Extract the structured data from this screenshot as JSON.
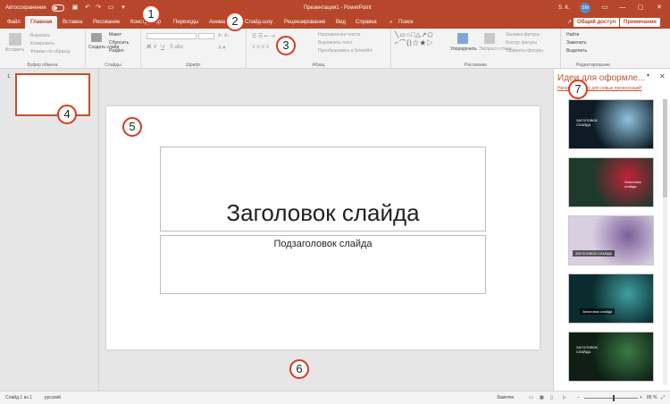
{
  "title_bar": {
    "autosave_label": "Автосохранение",
    "document_title": "Презентация1  -  PowerPoint",
    "user_initials": "SM",
    "user_short": "S. K."
  },
  "tabs": [
    "Файл",
    "Главная",
    "Вставка",
    "Рисование",
    "Конструктор",
    "Переходы",
    "Анимация",
    "Слайд-шоу",
    "Рецензирование",
    "Вид",
    "Справка"
  ],
  "search_label": "Поиск",
  "share_label": "Общий доступ",
  "comments_label": "Примечания",
  "ribbon": {
    "groups": [
      {
        "label": "Буфер обмена",
        "items": [
          "Вставить",
          "Вырезать",
          "Копировать",
          "Формат по образцу"
        ]
      },
      {
        "label": "Слайды",
        "items": [
          "Создать слайд",
          "Макет",
          "Сбросить",
          "Раздел"
        ]
      },
      {
        "label": "Шрифт",
        "items": []
      },
      {
        "label": "Абзац",
        "items": [
          "Направление текста",
          "Выровнять текст",
          "Преобразовать в SmartArt"
        ]
      },
      {
        "label": "Рисование",
        "items": [
          "Упорядочить",
          "Экспресс-стили",
          "Заливка фигуры",
          "Контур фигуры",
          "Эффекты фигуры"
        ]
      },
      {
        "label": "Редактирование",
        "items": [
          "Найти",
          "Заменить",
          "Выделить"
        ]
      }
    ]
  },
  "thumbnails": {
    "slide_number": "1"
  },
  "slide": {
    "title": "Заголовок слайда",
    "subtitle": "Подзаголовок слайда"
  },
  "designer": {
    "title": "Идеи для оформле...",
    "link": "Начните работу для новых презентаций!",
    "designs": [
      {
        "caption": "ЗАГОЛОВОК\nСЛАЙДА",
        "bg": "#0e1a24",
        "accent": "#8fc3dd"
      },
      {
        "caption": "Заголовок\nслайда",
        "bg": "#1d3a2c",
        "accent": "#c0223a"
      },
      {
        "caption": "ЗАГОЛОВОК СЛАЙДА",
        "bg": "#d9cfe0",
        "accent": "#7b5e9c"
      },
      {
        "caption": "Заголовок слайда",
        "bg": "#0b2c2e",
        "accent": "#3fa0a0"
      },
      {
        "caption": "ЗАГОЛОВОК\nСЛАЙДА",
        "bg": "#0f1f16",
        "accent": "#3b7a47"
      }
    ]
  },
  "status_bar": {
    "slide_info": "Слайд 1 из 1",
    "language": "русский",
    "notes_label": "Заметки",
    "zoom": "85 %"
  },
  "markers": [
    "1",
    "2",
    "3",
    "4",
    "5",
    "6",
    "7"
  ],
  "colors": {
    "brand": "#b7472a",
    "accent": "#c4512b",
    "marker": "#d93a1e"
  }
}
